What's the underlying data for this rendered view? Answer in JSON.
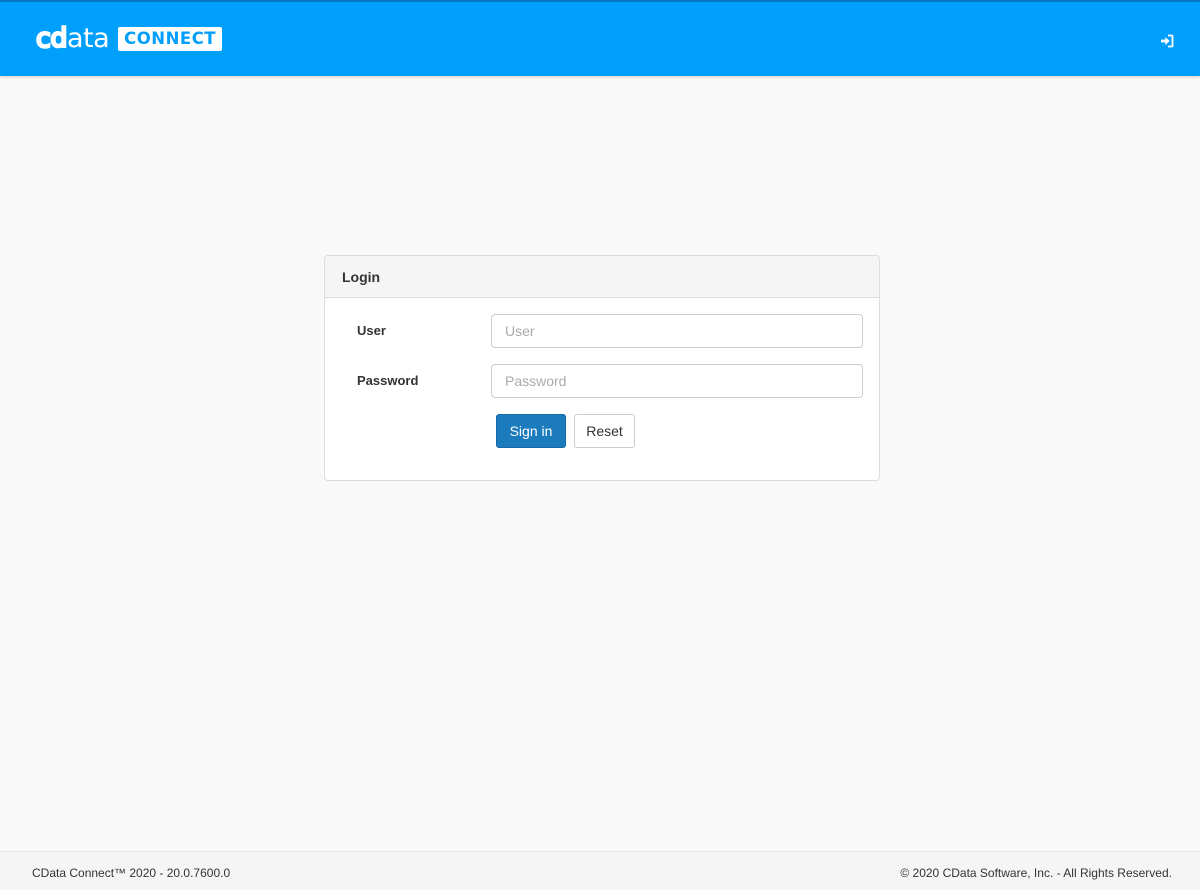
{
  "header": {
    "logo_word_hollow": "cd",
    "logo_word_solid": "ata",
    "logo_badge": "CONNECT",
    "signin_icon": "sign-in-icon",
    "colors": {
      "bar": "#009ffb",
      "bar_top_border": "#0b75c4"
    }
  },
  "login": {
    "title": "Login",
    "user_label": "User",
    "user_placeholder": "User",
    "user_value": "",
    "password_label": "Password",
    "password_placeholder": "Password",
    "password_value": "",
    "signin_label": "Sign in",
    "reset_label": "Reset",
    "colors": {
      "primary_button": "#1b7bbd"
    }
  },
  "footer": {
    "version_text": "CData Connect™ 2020 - 20.0.7600.0",
    "copyright_text": "© 2020 CData Software, Inc. - All Rights Reserved."
  }
}
